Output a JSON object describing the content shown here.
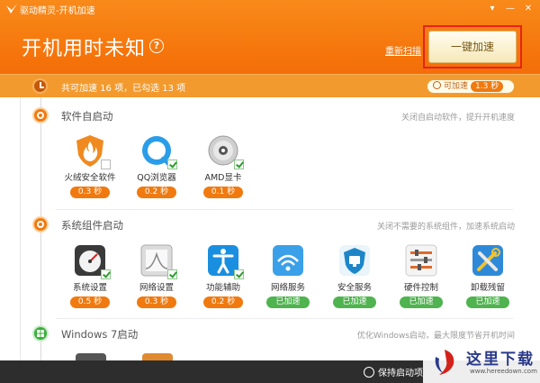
{
  "window": {
    "title": "驱动精灵-开机加速",
    "buttons": [
      "▾",
      "—",
      "✕"
    ]
  },
  "header": {
    "headline": "开机用时未知",
    "help": "?",
    "rescan_label": "重新扫描",
    "accelerate_label": "一键加速"
  },
  "summary": {
    "text": "共可加速 16 项，已勾选 13 项",
    "pill_label": "可加速",
    "pill_value": "1.3 秒"
  },
  "sections": [
    {
      "title": "软件自启动",
      "hint": "关闭自启动软件，提升开机速度",
      "items": [
        {
          "label": "火绒安全软件",
          "badge": "0.3 秒",
          "checked": false,
          "icon": "shield-flame-icon"
        },
        {
          "label": "QQ浏览器",
          "badge": "0.2 秒",
          "checked": true,
          "icon": "qq-browser-icon"
        },
        {
          "label": "AMD显卡",
          "badge": "0.1 秒",
          "checked": true,
          "icon": "amd-disc-icon"
        }
      ]
    },
    {
      "title": "系统组件启动",
      "hint": "关闭不需要的系统组件，加速系统启动",
      "items": [
        {
          "label": "系统设置",
          "badge": "0.5 秒",
          "checked": true,
          "icon": "gauge-icon",
          "done": false
        },
        {
          "label": "网络设置",
          "badge": "0.3 秒",
          "checked": true,
          "icon": "network-chart-icon",
          "done": false
        },
        {
          "label": "功能辅助",
          "badge": "0.2 秒",
          "checked": true,
          "icon": "accessibility-icon",
          "done": false
        },
        {
          "label": "网络服务",
          "badge": "已加速",
          "checked": false,
          "icon": "wifi-icon",
          "done": true
        },
        {
          "label": "安全服务",
          "badge": "已加速",
          "checked": false,
          "icon": "security-shield-icon",
          "done": true
        },
        {
          "label": "硬件控制",
          "badge": "已加速",
          "checked": false,
          "icon": "hardware-sliders-icon",
          "done": true
        },
        {
          "label": "卸载残留",
          "badge": "已加速",
          "checked": false,
          "icon": "tools-icon",
          "done": true
        }
      ]
    },
    {
      "title": "Windows 7启动",
      "hint": "优化Windows启动，最大限度节省开机时间"
    }
  ],
  "footer": {
    "save_label": "保持启动项"
  },
  "watermark": {
    "text": "这里下载",
    "url": "www.hereedown.com"
  },
  "colors": {
    "brand_orange": "#f5730a",
    "badge_orange": "#f07a10",
    "done_green": "#4fb34f",
    "highlight_red": "#e5231a"
  }
}
